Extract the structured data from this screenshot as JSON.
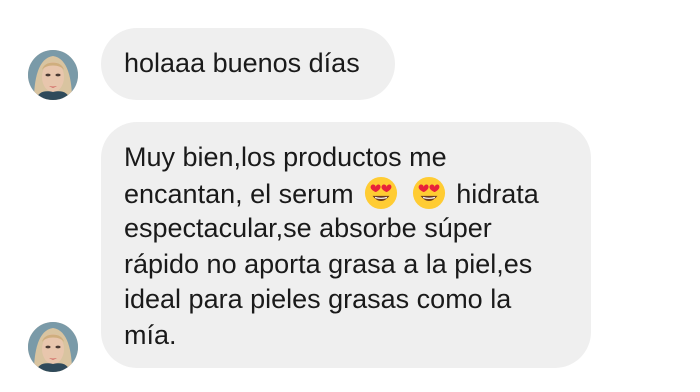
{
  "messages": [
    {
      "text": "holaaa buenos días"
    },
    {
      "line1": "Muy bien,los productos me",
      "line2_before": "encantan, el serum",
      "emoji_1": "heart-eyes-emoji",
      "emoji_2": "heart-eyes-emoji",
      "line2_after": "hidrata",
      "line3": "espectacular,se absorbe súper",
      "line4": "rápido no aporta grasa a la piel,es",
      "line5": "ideal para pieles grasas como la",
      "line6": "mía."
    }
  ],
  "colors": {
    "bubble_background": "#efefef",
    "text": "#1a1a1a",
    "background": "#ffffff"
  }
}
